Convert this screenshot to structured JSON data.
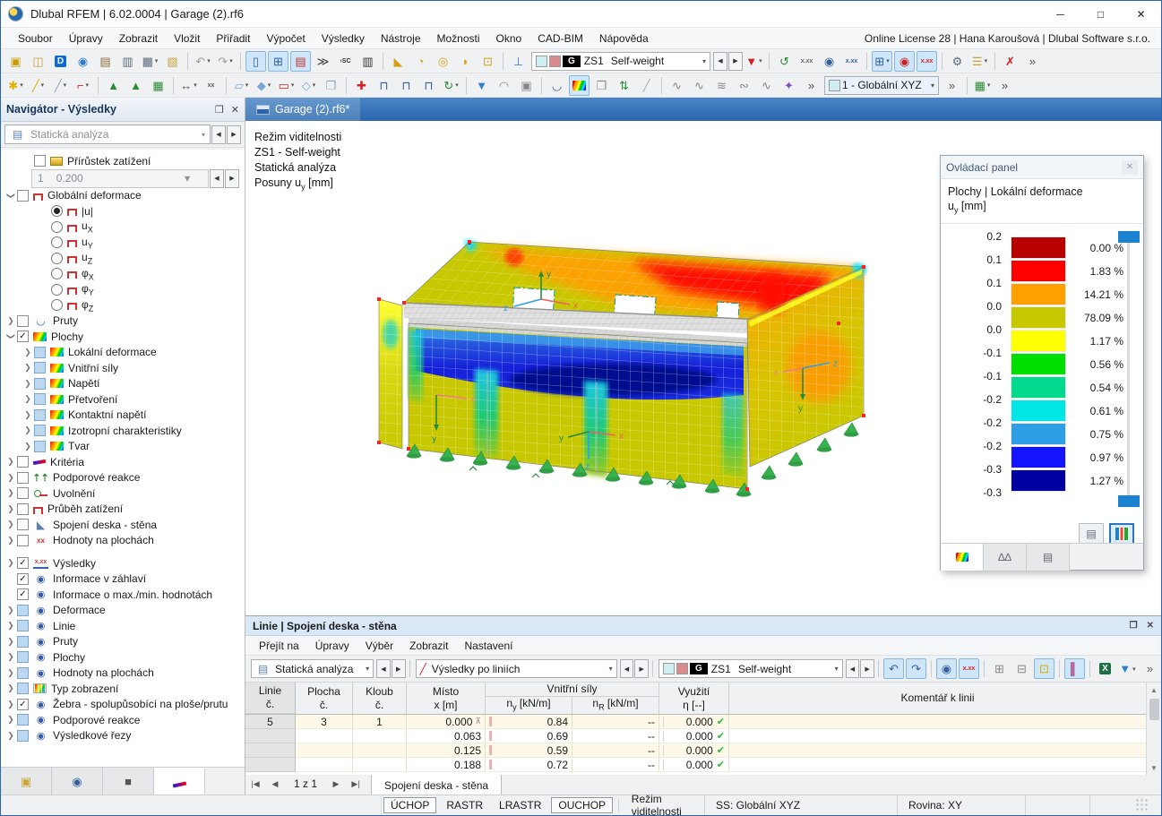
{
  "window": {
    "title": "Dlubal RFEM | 6.02.0004 | Garage (2).rf6",
    "controls": {
      "minimize": "─",
      "maximize": "□",
      "close": "✕"
    }
  },
  "menubar": {
    "items": [
      "Soubor",
      "Úpravy",
      "Zobrazit",
      "Vložit",
      "Přiřadit",
      "Výpočet",
      "Výsledky",
      "Nástroje",
      "Možnosti",
      "Okno",
      "CAD-BIM",
      "Nápověda"
    ],
    "right_text": "Online License 28 | Hana Karoušová | Dlubal Software s.r.o."
  },
  "toolbar_top": {
    "load_case_combo": {
      "g_badge": "G",
      "case_id": "ZS1",
      "case_name": "Self-weight"
    },
    "cs_combo": "1 - Globální XYZ",
    "icons_a": [
      {
        "n": "new-model-icon",
        "g": "▣",
        "c": "#c79a00"
      },
      {
        "n": "open-file-icon",
        "g": "◫",
        "c": "#caa53c"
      },
      {
        "n": "dlubal-d-icon",
        "g": "D",
        "c": "#0a6ad6",
        "b": true
      },
      {
        "n": "dlubal-online-icon",
        "g": "◉",
        "c": "#2e7dd1"
      },
      {
        "n": "manage-models-icon",
        "g": "▤",
        "c": "#8a6d3b"
      },
      {
        "n": "save-icon",
        "g": "▥",
        "c": "#5a6b7a"
      },
      {
        "n": "print-icon",
        "g": "▦",
        "c": "#5a6b7a",
        "dd": true
      },
      {
        "n": "printout-report-icon",
        "g": "▧",
        "c": "#caa53c"
      },
      {
        "sep": true
      },
      {
        "n": "undo-icon",
        "g": "↶",
        "c": "#9a9a9a",
        "dd": true
      },
      {
        "n": "redo-icon",
        "g": "↷",
        "c": "#9a9a9a",
        "dd": true
      },
      {
        "sep": true
      },
      {
        "n": "data-navigator-icon",
        "g": "▯",
        "c": "#2e5f9e",
        "hl": true
      },
      {
        "n": "tables-panel-icon",
        "g": "⊞",
        "c": "#2e5f9e",
        "hl": true
      },
      {
        "n": "results-navigator-icon",
        "g": "▤",
        "c": "#c03030",
        "hl": true
      },
      {
        "n": "console-icon",
        "g": "≫",
        "c": "#333333"
      },
      {
        "n": "script-console-icon",
        "t": "›SC",
        "c": "#333333"
      },
      {
        "n": "printout-panel-icon",
        "g": "▥",
        "c": "#333333"
      },
      {
        "sep": true
      },
      {
        "n": "select-polygon-icon",
        "g": "◣",
        "c": "#d4a017"
      },
      {
        "n": "select-circle-icon",
        "g": "◔",
        "c": "#d4a017"
      },
      {
        "n": "select-ring-icon",
        "g": "◎",
        "c": "#d4a017"
      },
      {
        "n": "select-freehand-icon",
        "g": "◗",
        "c": "#d4a017"
      },
      {
        "n": "select-box-icon",
        "g": "⊡",
        "c": "#d4a017"
      },
      {
        "sep": true
      },
      {
        "n": "snap-settings-icon",
        "g": "⊥",
        "c": "#2e7dd1"
      }
    ],
    "icons_b": [
      {
        "n": "filter-results-icon",
        "g": "▼",
        "c": "#cf2121",
        "dd": true
      },
      {
        "sep": true
      },
      {
        "n": "smooth-results-icon",
        "g": "↺",
        "c": "#2a8a36"
      },
      {
        "n": "result-values-icon",
        "t": "x.xx",
        "c": "#666666"
      },
      {
        "n": "show-results-icon",
        "g": "◉",
        "c": "#355f9e"
      },
      {
        "n": "show-values-icon",
        "t": "x.xx",
        "c": "#355f9e"
      },
      {
        "sep": true
      },
      {
        "n": "grid-values-icon",
        "g": "⊞",
        "c": "#355f9e",
        "hl": true,
        "dd": true
      },
      {
        "n": "result-diagram-icon",
        "g": "◉",
        "c": "#cf2121",
        "hl": true
      },
      {
        "n": "result-numbers-icon",
        "t": "x.xx",
        "c": "#cf2121",
        "hl": true
      },
      {
        "sep": true
      },
      {
        "n": "calculation-settings-icon",
        "g": "⚙",
        "c": "#5a6b7a"
      },
      {
        "n": "abacus-icon",
        "g": "☰",
        "c": "#caa53c",
        "dd": true
      },
      {
        "sep": true
      },
      {
        "n": "deactivate-results-icon",
        "g": "✗",
        "c": "#cf2121"
      },
      {
        "n": "toolbar-overflow-icon",
        "g": "»",
        "c": "#555555"
      }
    ],
    "icons2_a": [
      {
        "n": "node-tool-icon",
        "g": "✱",
        "c": "#e0b000",
        "dd": true
      },
      {
        "n": "line-tool-icon",
        "g": "╱",
        "c": "#e0b000",
        "dd": true
      },
      {
        "n": "line-type-tool-icon",
        "g": "╱",
        "c": "#8fa7c0",
        "dd": true
      },
      {
        "n": "polyline-tool-icon",
        "g": "⌐",
        "c": "#cf2121",
        "dd": true
      },
      {
        "sep": true
      },
      {
        "n": "member-tool-icon",
        "g": "▲",
        "c": "#2a8a36"
      },
      {
        "n": "member-set-tool-icon",
        "g": "▲",
        "c": "#2a8a36"
      },
      {
        "n": "structure-tool-icon",
        "g": "▦",
        "c": "#2a8a36"
      },
      {
        "sep": true
      },
      {
        "n": "dimension-x-icon",
        "g": "↔",
        "c": "#555555",
        "dd": true
      },
      {
        "n": "dimension-xx-icon",
        "t": "xx",
        "c": "#555555"
      },
      {
        "sep": true
      },
      {
        "n": "surface-tool-icon",
        "g": "▱",
        "c": "#7aa7d6",
        "dd": true
      },
      {
        "n": "solid-tool-icon",
        "g": "◆",
        "c": "#7aa7d6",
        "dd": true
      },
      {
        "n": "opening-tool-icon",
        "g": "▭",
        "c": "#cf2121",
        "dd": true
      },
      {
        "n": "block-tool-icon",
        "g": "◇",
        "c": "#7aa7d6",
        "dd": true
      },
      {
        "n": "cube-tool-icon",
        "g": "❒",
        "c": "#8fa7c0"
      },
      {
        "sep": true
      },
      {
        "n": "support-node-icon",
        "g": "✚",
        "c": "#cf2121"
      },
      {
        "n": "support-line-icon",
        "g": "⊓",
        "c": "#355f9e"
      },
      {
        "n": "support-line2-icon",
        "g": "⊓",
        "c": "#355f9e"
      },
      {
        "n": "support-surface-icon",
        "g": "⊓",
        "c": "#355f9e"
      },
      {
        "n": "hinge-tool-icon",
        "g": "↻",
        "c": "#2a8a36",
        "dd": true
      },
      {
        "sep": true
      },
      {
        "n": "view-filter-icon",
        "g": "▼",
        "c": "#2e7dd1"
      },
      {
        "n": "partial-view-icon",
        "g": "◠",
        "c": "#888888"
      },
      {
        "n": "clipping-box-icon",
        "g": "▣",
        "c": "#888888"
      },
      {
        "sep": true
      },
      {
        "n": "member-results-icon",
        "g": "◡",
        "c": "#355f9e"
      },
      {
        "n": "surface-results-icon",
        "rainbow": true,
        "hl": true
      },
      {
        "n": "render-mode-icon",
        "g": "❒",
        "c": "#888888"
      },
      {
        "n": "deformed-view-icon",
        "g": "⇅",
        "c": "#2a8a36"
      },
      {
        "n": "section-tool-icon",
        "g": "╱",
        "c": "#aaaaaa"
      },
      {
        "sep": true
      },
      {
        "n": "result-diagram1-icon",
        "g": "∿",
        "c": "#888888"
      },
      {
        "n": "result-diagram2-icon",
        "g": "∿",
        "c": "#888888"
      },
      {
        "n": "result-diagram3-icon",
        "g": "≋",
        "c": "#888888"
      },
      {
        "n": "result-diagram4-icon",
        "g": "∾",
        "c": "#888888"
      },
      {
        "n": "result-diagram5-icon",
        "g": "∿",
        "c": "#888888"
      },
      {
        "n": "magic-display-icon",
        "g": "✦",
        "c": "#7a4fc0"
      },
      {
        "n": "toolbar2-overflow-icon",
        "g": "»",
        "c": "#555555"
      }
    ],
    "icons2_b": [
      {
        "n": "cs-overflow-icon",
        "g": "»",
        "c": "#555555"
      },
      {
        "sep": true
      },
      {
        "n": "visual-settings-icon",
        "g": "▦",
        "c": "#2a8a36",
        "dd": true
      },
      {
        "n": "toolbar2-end-overflow-icon",
        "g": "»",
        "c": "#555555"
      }
    ]
  },
  "navigator": {
    "title": "Navigátor - Výsledky",
    "combo": "Statická analýza",
    "increment": {
      "v1": "1",
      "v2": "0.200"
    },
    "tree": [
      {
        "d": 1,
        "c": "cb0",
        "i": "layers",
        "t": "Přírůstek zatížení"
      },
      {
        "inc": true
      },
      {
        "d": 0,
        "e": "v",
        "c": "cb0",
        "i": "frame",
        "t": "Globální deformace"
      },
      {
        "d": 2,
        "c": "r1",
        "i": "frame",
        "t": "|u|"
      },
      {
        "d": 2,
        "c": "r0",
        "i": "frame",
        "t": "u",
        "sub": "X"
      },
      {
        "d": 2,
        "c": "r0",
        "i": "frame",
        "t": "u",
        "sub": "Y"
      },
      {
        "d": 2,
        "c": "r0",
        "i": "frame",
        "t": "u",
        "sub": "Z"
      },
      {
        "d": 2,
        "c": "r0",
        "i": "frame",
        "t": "φ",
        "sub": "X"
      },
      {
        "d": 2,
        "c": "r0",
        "i": "frame",
        "t": "φ",
        "sub": "Y"
      },
      {
        "d": 2,
        "c": "r0",
        "i": "frame",
        "t": "φ",
        "sub": "Z"
      },
      {
        "d": 0,
        "e": ">",
        "c": "cb0",
        "i": "vcurve",
        "t": "Pruty"
      },
      {
        "d": 0,
        "e": "v",
        "c": "cb1",
        "i": "rainbow",
        "t": "Plochy"
      },
      {
        "d": 1,
        "e": ">",
        "c": "cbp",
        "i": "rainbow",
        "t": "Lokální deformace"
      },
      {
        "d": 1,
        "e": ">",
        "c": "cbp",
        "i": "rainbow",
        "t": "Vnitřní síly"
      },
      {
        "d": 1,
        "e": ">",
        "c": "cbp",
        "i": "rainbow",
        "t": "Napětí"
      },
      {
        "d": 1,
        "e": ">",
        "c": "cbp",
        "i": "rainbow",
        "t": "Přetvoření"
      },
      {
        "d": 1,
        "e": ">",
        "c": "cbp",
        "i": "rainbow",
        "t": "Kontaktní napětí"
      },
      {
        "d": 1,
        "e": ">",
        "c": "cbp",
        "i": "rainbow",
        "t": "Izotropní charakteristiky"
      },
      {
        "d": 1,
        "e": ">",
        "c": "cbp",
        "i": "rainbow",
        "t": "Tvar"
      },
      {
        "d": 0,
        "e": ">",
        "c": "cb0",
        "i": "crit",
        "t": "Kritéria"
      },
      {
        "d": 0,
        "e": ">",
        "c": "cb0",
        "i": "supp",
        "t": "Podporové reakce"
      },
      {
        "d": 0,
        "e": ">",
        "c": "cb0",
        "i": "rel",
        "t": "Uvolnění"
      },
      {
        "d": 0,
        "e": ">",
        "c": "cb0",
        "i": "frame",
        "t": "Průběh zatížení"
      },
      {
        "d": 0,
        "e": ">",
        "c": "cb0",
        "i": "plate",
        "t": "Spojení deska - stěna"
      },
      {
        "d": 0,
        "e": ">",
        "c": "cb0",
        "i": "valxx",
        "t": "Hodnoty na plochách"
      },
      {
        "gap": true
      },
      {
        "d": 0,
        "e": ">",
        "c": "cb1",
        "i": "xxx",
        "t": "Výsledky"
      },
      {
        "d": 0,
        "c": "cb1",
        "i": "info",
        "t": "Informace v záhlaví"
      },
      {
        "d": 0,
        "c": "cb1",
        "i": "info",
        "t": "Informace o max./min. hodnotách"
      },
      {
        "d": 0,
        "e": ">",
        "c": "cbp",
        "i": "info",
        "t": "Deformace"
      },
      {
        "d": 0,
        "e": ">",
        "c": "cbp",
        "i": "info",
        "t": "Linie"
      },
      {
        "d": 0,
        "e": ">",
        "c": "cbp",
        "i": "info",
        "t": "Pruty"
      },
      {
        "d": 0,
        "e": ">",
        "c": "cbp",
        "i": "info",
        "t": "Plochy"
      },
      {
        "d": 0,
        "e": ">",
        "c": "cbp",
        "i": "info",
        "t": "Hodnoty na plochách"
      },
      {
        "d": 0,
        "e": ">",
        "c": "cbp",
        "i": "disp",
        "t": "Typ zobrazení"
      },
      {
        "d": 0,
        "e": ">",
        "c": "cb1",
        "i": "info",
        "t": "Žebra - spolupůsobící na ploše/prutu"
      },
      {
        "d": 0,
        "e": ">",
        "c": "cbp",
        "i": "info",
        "t": "Podporové reakce"
      },
      {
        "d": 0,
        "e": ">",
        "c": "cbp",
        "i": "info",
        "t": "Výsledkové řezy"
      }
    ],
    "tabs": [
      {
        "n": "navigator-data-tab",
        "g": "▣",
        "c": "#caa53c"
      },
      {
        "n": "navigator-views-tab",
        "g": "◉",
        "c": "#355f9e"
      },
      {
        "n": "navigator-camera-tab",
        "g": "■",
        "c": "#555555"
      },
      {
        "n": "navigator-results-tab",
        "crit": true,
        "sel": true
      }
    ]
  },
  "viewport": {
    "tab": "Garage (2).rf6*",
    "overlay": [
      "Režim viditelnosti",
      "ZS1 - Self-weight",
      "Statická analýza"
    ],
    "overlay_quantity": {
      "pre": "Posuny u",
      "sub": "y",
      "post": " [mm]"
    },
    "axis": {
      "x": "x",
      "y": "y",
      "z": "z"
    }
  },
  "panel": {
    "title": "Ovládací panel",
    "subtitle": "Plochy | Lokální deformace",
    "quantity": {
      "pre": "u",
      "sub": "y",
      "post": " [mm]"
    },
    "boundaries": [
      "0.2",
      "0.1",
      "0.1",
      "0.0",
      "0.0",
      "-0.1",
      "-0.1",
      "-0.2",
      "-0.2",
      "-0.2",
      "-0.3",
      "-0.3"
    ],
    "bands": [
      {
        "color": "#b80000",
        "pct": "0.00 %"
      },
      {
        "color": "#ff0000",
        "pct": "1.83 %"
      },
      {
        "color": "#ffa000",
        "pct": "14.21 %"
      },
      {
        "color": "#c8c800",
        "pct": "78.09 %"
      },
      {
        "color": "#ffff00",
        "pct": "1.17 %"
      },
      {
        "color": "#00e000",
        "pct": "0.56 %"
      },
      {
        "color": "#00d98e",
        "pct": "0.54 %"
      },
      {
        "color": "#00e5e5",
        "pct": "0.61 %"
      },
      {
        "color": "#2e9fe6",
        "pct": "0.75 %"
      },
      {
        "color": "#1414ff",
        "pct": "0.97 %"
      },
      {
        "color": "#0000a0",
        "pct": "1.27 %"
      }
    ]
  },
  "bottom": {
    "title": "Linie | Spojení deska - stěna",
    "menu": [
      "Přejít na",
      "Úpravy",
      "Výběr",
      "Zobrazit",
      "Nastavení"
    ],
    "combo_analysis": "Statická analýza",
    "combo_results": "Výsledky po liniích",
    "combo_case": {
      "g_badge": "G",
      "case_id": "ZS1",
      "case_name": "Self-weight"
    },
    "icons": [
      {
        "n": "jump-back-icon",
        "g": "↶",
        "c": "#355f9e",
        "hl": true
      },
      {
        "n": "jump-forward-icon",
        "g": "↷",
        "c": "#355f9e",
        "hl": true
      },
      {
        "sep": true
      },
      {
        "n": "show-result-icon",
        "g": "◉",
        "c": "#355f9e",
        "hl": true
      },
      {
        "n": "show-values-icon",
        "t": "x.xx",
        "c": "#cf2121",
        "hl": true
      },
      {
        "sep": true
      },
      {
        "n": "table-view-icon",
        "g": "⊞",
        "c": "#888888"
      },
      {
        "n": "table-link-icon",
        "g": "⊟",
        "c": "#888888"
      },
      {
        "n": "table-highlight-icon",
        "g": "⊡",
        "c": "#d0b000",
        "hl": true
      },
      {
        "sep": true
      },
      {
        "n": "table-chart-icon",
        "g": "▌",
        "c": "#b06aa0",
        "hl": true
      },
      {
        "sep": true
      },
      {
        "n": "export-excel-icon",
        "g": "X",
        "c": "#1d6f42",
        "b": true
      },
      {
        "n": "table-filter-icon",
        "g": "▼",
        "c": "#2e7dd1",
        "dd": true
      },
      {
        "n": "table-overflow-icon",
        "g": "»",
        "c": "#555555"
      }
    ],
    "table": {
      "headers": {
        "linie1": "Linie",
        "linie2": "č.",
        "plocha1": "Plocha",
        "plocha2": "č.",
        "kloub1": "Kloub",
        "kloub2": "č.",
        "misto1": "Místo",
        "misto2": "x [m]",
        "vnitrni": "Vnitřní síly",
        "ny": {
          "pre": "n",
          "sub": "y",
          "post": " [kN/m]"
        },
        "nr": {
          "pre": "n",
          "sub": "R",
          "post": " [kN/m]"
        },
        "vyuziti": "Využití",
        "eta": "η [--]",
        "komentar": "Komentář k linii"
      },
      "rows": [
        {
          "linie": "5",
          "plocha": "3",
          "kloub": "1",
          "x": "0.000",
          "xmark": true,
          "ny": "0.84",
          "nr": "--",
          "eta": "0.000",
          "ok": true
        },
        {
          "linie": "",
          "plocha": "",
          "kloub": "",
          "x": "0.063",
          "ny": "0.69",
          "nr": "--",
          "eta": "0.000",
          "ok": true
        },
        {
          "linie": "",
          "plocha": "",
          "kloub": "",
          "x": "0.125",
          "ny": "0.59",
          "nr": "--",
          "eta": "0.000",
          "ok": true
        },
        {
          "linie": "",
          "plocha": "",
          "kloub": "",
          "x": "0.188",
          "ny": "0.72",
          "nr": "--",
          "eta": "0.000",
          "ok": true
        }
      ]
    },
    "footer": {
      "first": "|◀",
      "prev": "◀",
      "pager": "1 z 1",
      "next": "▶",
      "last": "▶|",
      "tab": "Spojení deska - stěna"
    }
  },
  "statusbar": {
    "snap": "ÚCHOP",
    "grid": "RASTR",
    "lgrid": "LRASTR",
    "osnap": "OUCHOP",
    "mode": "Režim viditelnosti",
    "cs": "SS: Globální XYZ",
    "plane": "Rovina: XY"
  },
  "colors": {
    "accent": "#2b66ad",
    "legend": [
      "#b80000",
      "#ff0000",
      "#ffa000",
      "#c8c800",
      "#ffff00",
      "#00e000",
      "#00d98e",
      "#00e5e5",
      "#2e9fe6",
      "#1414ff",
      "#0000a0"
    ]
  }
}
